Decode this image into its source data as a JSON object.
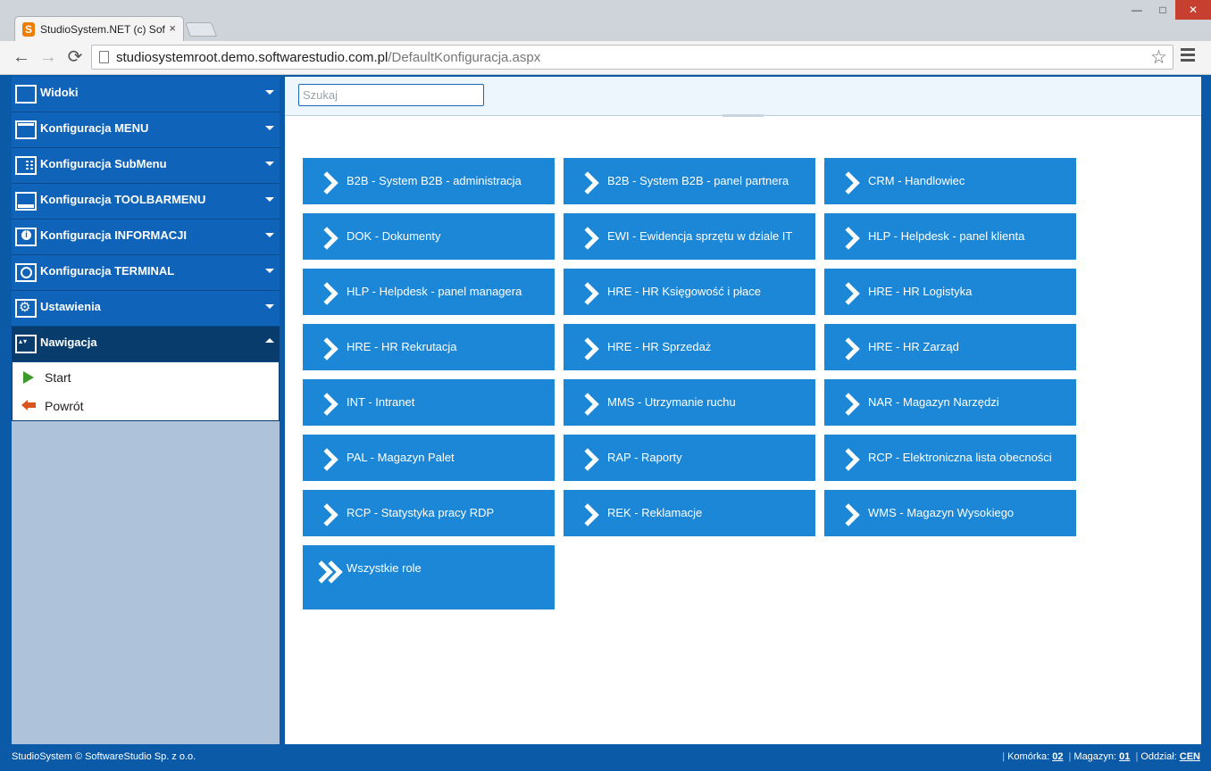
{
  "browser": {
    "tab_title": "StudioSystem.NET (c) Soft",
    "favicon_letter": "S",
    "tab_close": "×",
    "url_host": "studiosystemroot.demo.softwarestudio.com.pl",
    "url_path": "/DefaultKonfiguracja.aspx",
    "controls": {
      "minimize": "—",
      "maximize": "□",
      "close": "✕"
    },
    "nav": {
      "back": "←",
      "forward": "→",
      "reload": "⟳",
      "star": "☆"
    }
  },
  "sidebar": {
    "sections": [
      {
        "label": "Widoki",
        "icon": "grid-icon"
      },
      {
        "label": "Konfiguracja MENU",
        "icon": "window-icon"
      },
      {
        "label": "Konfiguracja SubMenu",
        "icon": "submenu-icon"
      },
      {
        "label": "Konfiguracja TOOLBARMENU",
        "icon": "toolbar-icon"
      },
      {
        "label": "Konfiguracja INFORMACJI",
        "icon": "info-icon"
      },
      {
        "label": "Konfiguracja TERMINAL",
        "icon": "terminal-icon"
      },
      {
        "label": "Ustawienia",
        "icon": "settings-icon"
      },
      {
        "label": "Nawigacja",
        "icon": "navigation-icon",
        "expanded": true
      }
    ],
    "navigation_items": [
      {
        "label": "Start",
        "icon": "play-icon"
      },
      {
        "label": "Powrót",
        "icon": "back-arrow-icon"
      }
    ]
  },
  "search": {
    "placeholder": "Szukaj",
    "value": ""
  },
  "tiles": [
    "B2B - System B2B - administracja",
    "B2B - System B2B - panel partnera",
    "CRM - Handlowiec",
    "DOK - Dokumenty",
    "EWI - Ewidencja sprzętu w dziale IT",
    "HLP - Helpdesk - panel klienta",
    "HLP - Helpdesk - panel managera",
    "HRE - HR Księgowość i płace",
    "HRE - HR Logistyka",
    "HRE - HR Rekrutacja",
    "HRE - HR Sprzedaż",
    "HRE - HR Zarząd",
    "INT - Intranet",
    "MMS - Utrzymanie ruchu",
    "NAR - Magazyn Narzędzi",
    "PAL - Magazyn Palet",
    "RAP - Raporty",
    "RCP - Elektroniczna lista obecności",
    "RCP - Statystyka pracy RDP",
    "REK - Reklamacje",
    "WMS - Magazyn Wysokiego"
  ],
  "all_roles_tile": "Wszystkie role",
  "status": {
    "copyright": "StudioSystem © SoftwareStudio Sp. z o.o.",
    "komorka_label": "Komórka:",
    "komorka_value": "02",
    "magazyn_label": "Magazyn:",
    "magazyn_value": "01",
    "oddzial_label": "Oddział:",
    "oddzial_value": "CEN"
  },
  "colors": {
    "sidebar_section": "#0f63b8",
    "sidebar_active": "#083c6d",
    "tile": "#1b87d6",
    "frame": "#0a5aa8"
  }
}
